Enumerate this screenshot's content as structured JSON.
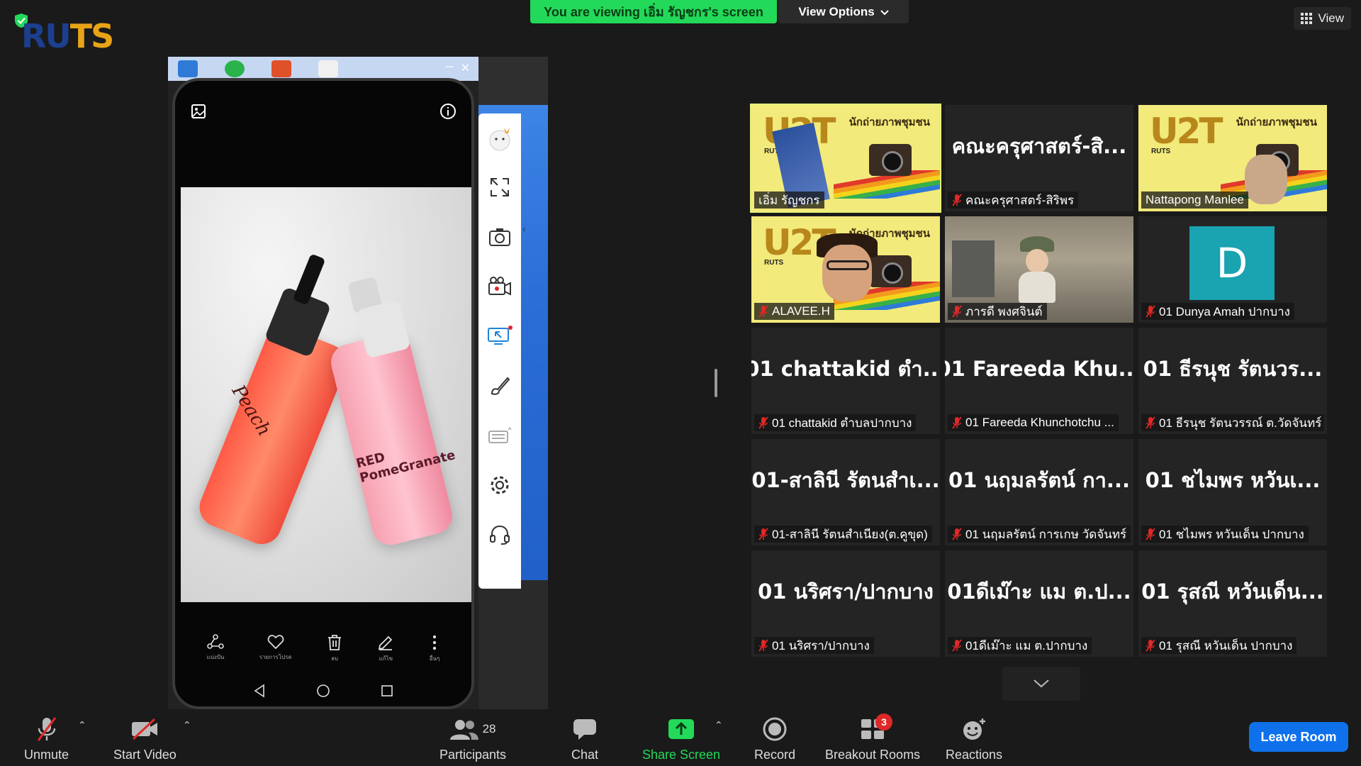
{
  "banner": {
    "viewing_text": "You are viewing เอิ่ม รัญชกร's screen",
    "view_options": "View Options",
    "view": "View"
  },
  "logo": {
    "text_r": "RU",
    "text_t": "TS",
    "sub_1": "",
    "sub_2": ""
  },
  "phone": {
    "product_1_label": "Peach",
    "product_2_label": "RED PomeGranate",
    "actions": [
      {
        "label": "แบ่งปัน",
        "icon": "share-icon"
      },
      {
        "label": "รายการโปรด",
        "icon": "heart-icon"
      },
      {
        "label": "ลบ",
        "icon": "trash-icon"
      },
      {
        "label": "แก้ไข",
        "icon": "edit-icon"
      },
      {
        "label": "อื่นๆ",
        "icon": "more-icon"
      }
    ]
  },
  "gallery": {
    "tiles": [
      {
        "name": "เอิ่ม รัญชกร",
        "muted": false,
        "kind": "banner",
        "active": true
      },
      {
        "big": "คณะครุศาสตร์-สิ...",
        "name": "คณะครุศาสตร์-สิริพร",
        "muted": true,
        "kind": "text"
      },
      {
        "name": "Nattapong Manlee",
        "muted": false,
        "kind": "banner"
      },
      {
        "name": "ALAVEE.H",
        "muted": true,
        "kind": "banner-face"
      },
      {
        "name": "ภารดี พงศจินต์",
        "muted": true,
        "kind": "photo"
      },
      {
        "avatar": "D",
        "name": "01 Dunya Amah ปากบาง",
        "muted": true,
        "kind": "avatar"
      },
      {
        "big": "01 chattakid ตำ...",
        "name": "01 chattakid ตำบลปากบาง",
        "muted": true,
        "kind": "text"
      },
      {
        "big": "01 Fareeda Khu...",
        "name": "01 Fareeda Khunchotchu ...",
        "muted": true,
        "kind": "text"
      },
      {
        "big": "01 ธีรนุช รัตนวร...",
        "name": "01 ธีรนุช รัตนวรรณ์ ต.วัดจันทร์",
        "muted": true,
        "kind": "text"
      },
      {
        "big": "01-สาลินี รัตนสำเ...",
        "name": "01-สาลินี รัตนสำเนียง(ต.คูขุด)",
        "muted": true,
        "kind": "text"
      },
      {
        "big": "01 นฤมลรัตน์ กา...",
        "name": "01 นฤมลรัตน์ การเกษ วัดจันทร์",
        "muted": true,
        "kind": "text"
      },
      {
        "big": "01 ชไมพร หวันเ...",
        "name": "01 ชไมพร หวันเด็น ปากบาง",
        "muted": true,
        "kind": "text"
      },
      {
        "big": "01 นริศรา/ปากบาง",
        "name": "01 นริศรา/ปากบาง",
        "muted": true,
        "kind": "text"
      },
      {
        "big": "01ดีเม๊าะ แม ต.ป...",
        "name": "01ดีเม๊าะ แม ต.ปากบาง",
        "muted": true,
        "kind": "text"
      },
      {
        "big": "01 รุสณี หวันเด็น...",
        "name": "01 รุสณี หวันเด็น ปากบาง",
        "muted": true,
        "kind": "text"
      }
    ],
    "banner_text_th": "นักถ่ายภาพชุมชน",
    "banner_u2t": "U2T",
    "banner_rut": "RUTS"
  },
  "toolbar": {
    "unmute": "Unmute",
    "start_video": "Start Video",
    "participants": "Participants",
    "participants_count": "28",
    "chat": "Chat",
    "share_screen": "Share Screen",
    "record": "Record",
    "breakout_rooms": "Breakout Rooms",
    "breakout_badge": "3",
    "reactions": "Reactions",
    "leave_room": "Leave Room"
  },
  "colors": {
    "share_green": "#23d959",
    "leave_blue": "#0e71eb",
    "active_outline": "#e8f07a",
    "badge_red": "#e02828"
  }
}
